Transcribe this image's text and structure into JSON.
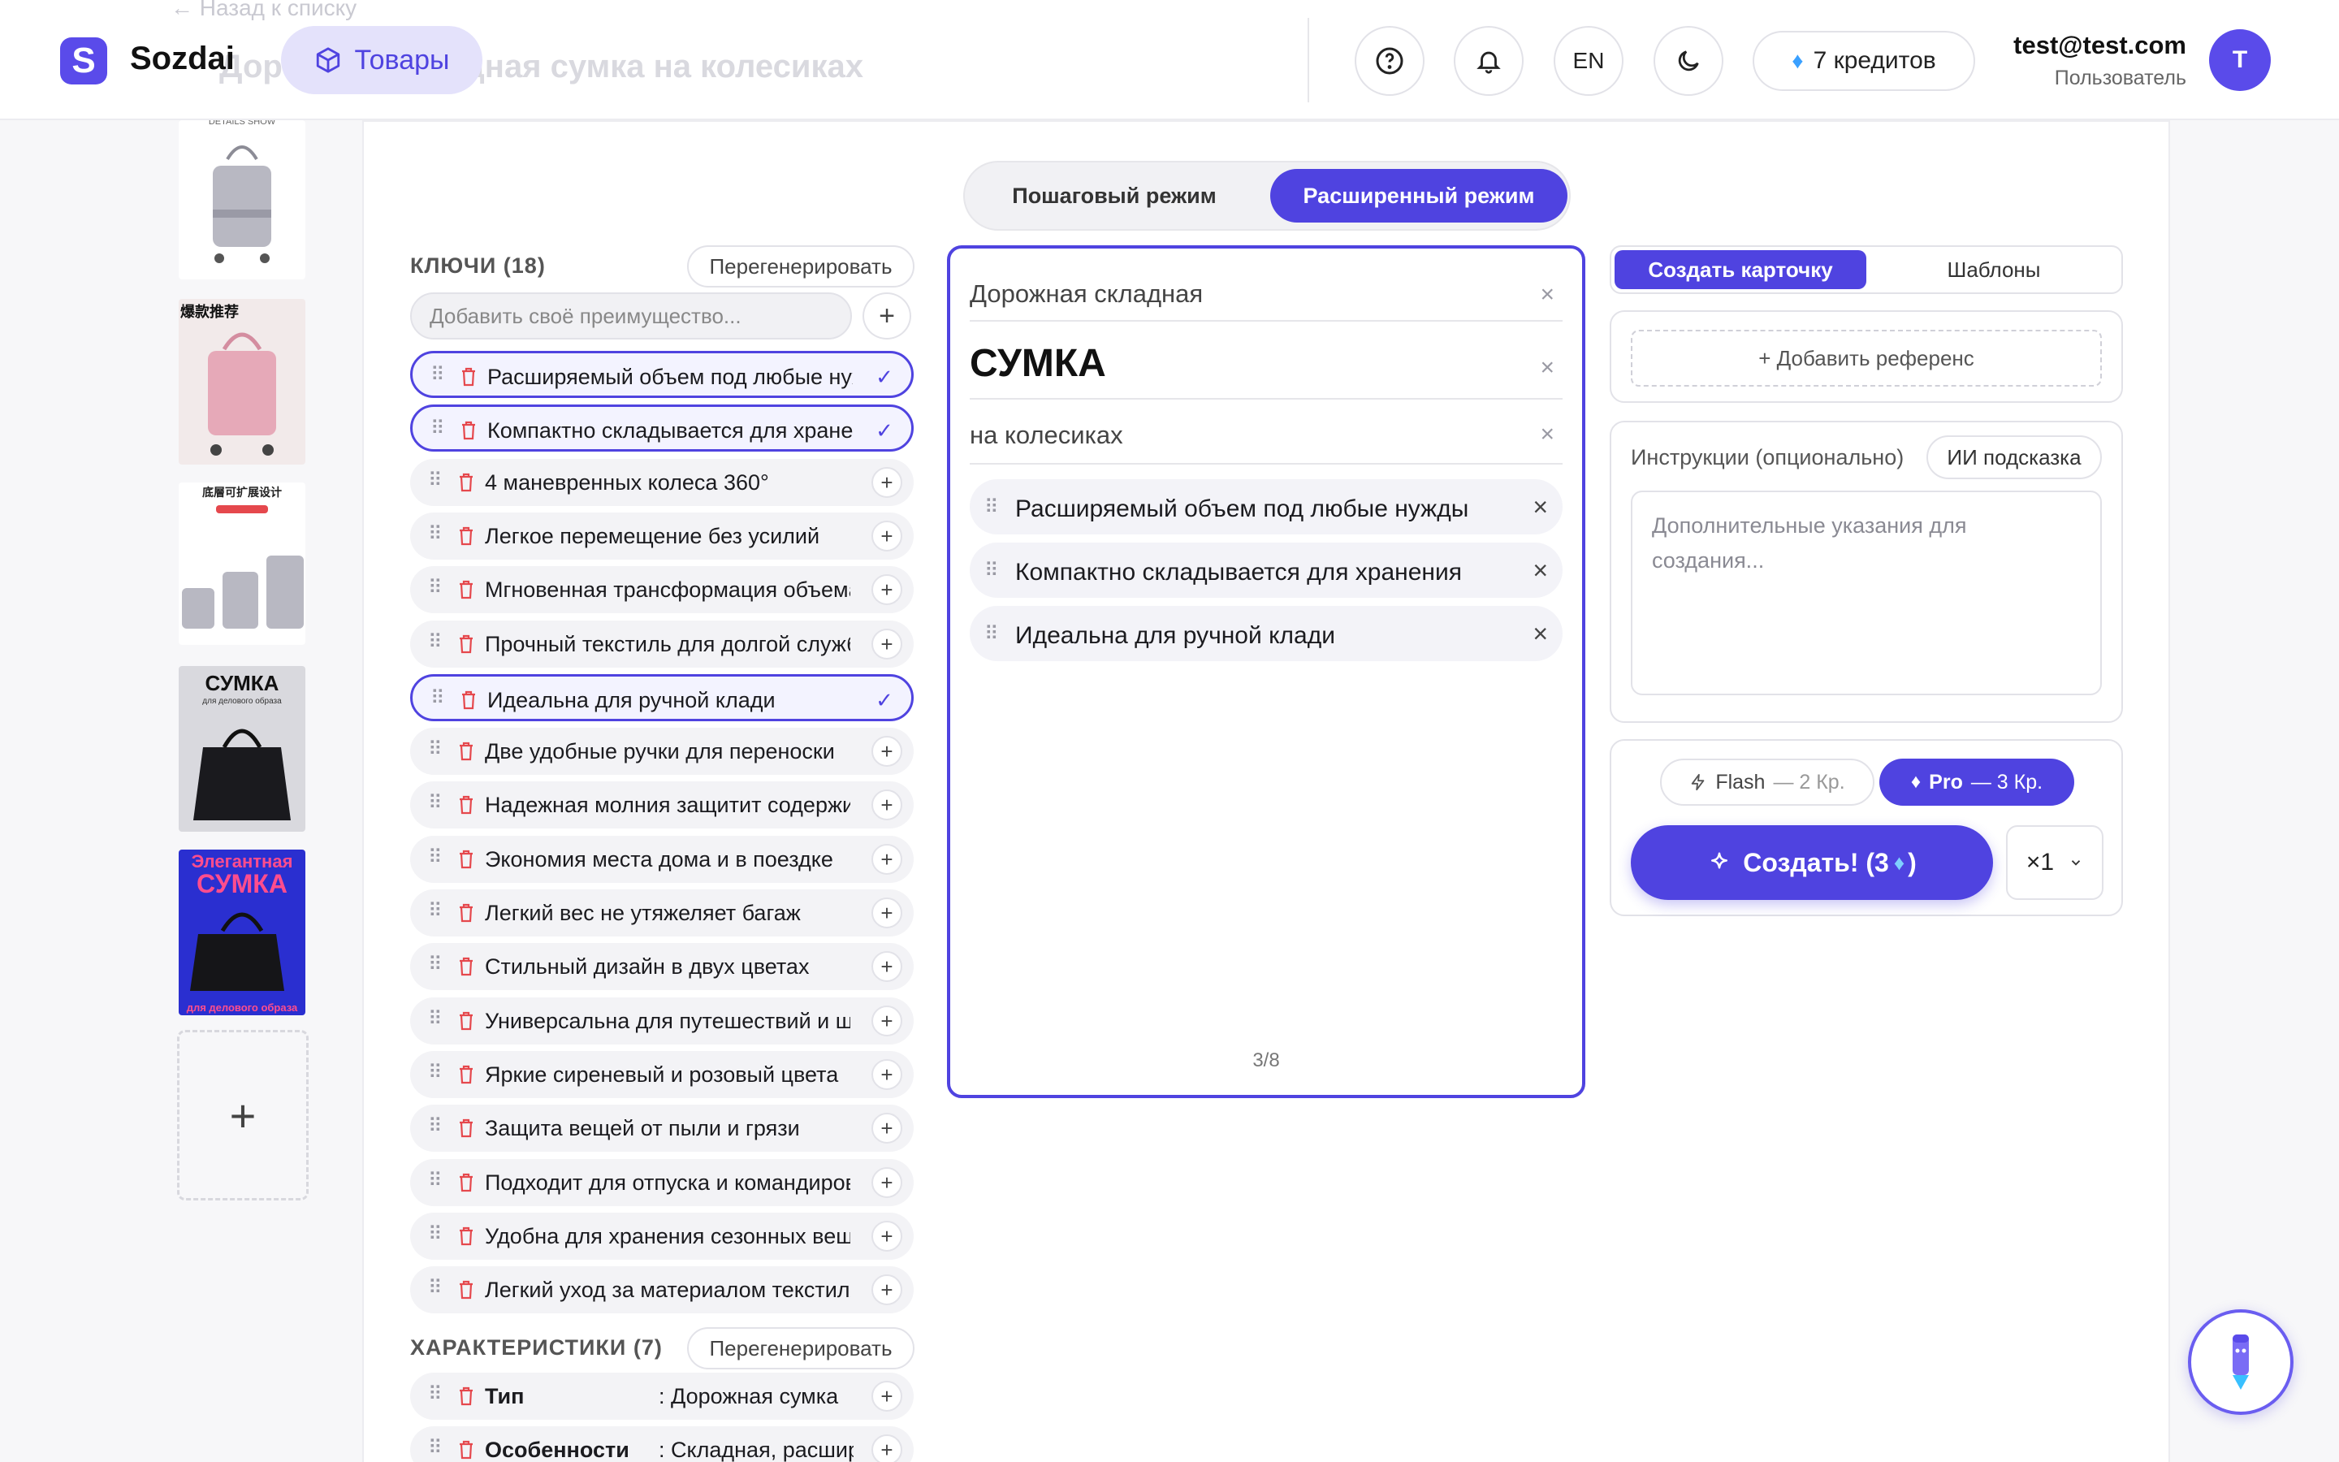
{
  "header": {
    "logo_mark": "S",
    "app_name": "Sozdai",
    "back_link": "← Назад к списку",
    "page_title": "Дорожная складная сумка на колесиках",
    "nav_label": "Товары",
    "lang": "EN",
    "credits": "7 кредитов",
    "user_email": "test@test.com",
    "user_role": "Пользователь",
    "avatar_letter": "T"
  },
  "modes": {
    "step": "Пошаговый режим",
    "advanced": "Расширенный режим",
    "active": "advanced"
  },
  "keys": {
    "title": "КЛЮЧИ (18)",
    "regen_label": "Перегенерировать",
    "add_placeholder": "Добавить своё преимущество...",
    "items": [
      {
        "label": "Расширяемый объем под любые нужды",
        "selected": true
      },
      {
        "label": "Компактно складывается для хранения",
        "selected": true
      },
      {
        "label": "4 маневренных колеса 360°",
        "selected": false
      },
      {
        "label": "Легкое перемещение без усилий",
        "selected": false
      },
      {
        "label": "Мгновенная трансформация объема",
        "selected": false
      },
      {
        "label": "Прочный текстиль для долгой службы",
        "selected": false
      },
      {
        "label": "Идеальна для ручной клади",
        "selected": true
      },
      {
        "label": "Две удобные ручки для переноски",
        "selected": false
      },
      {
        "label": "Надежная молния защитит содержимое",
        "selected": false
      },
      {
        "label": "Экономия места дома и в поездке",
        "selected": false
      },
      {
        "label": "Легкий вес не утяжеляет багаж",
        "selected": false
      },
      {
        "label": "Стильный дизайн в двух цветах",
        "selected": false
      },
      {
        "label": "Универсальна для путешествий и шопинга",
        "selected": false
      },
      {
        "label": "Яркие сиреневый и розовый цвета",
        "selected": false
      },
      {
        "label": "Защита вещей от пыли и грязи",
        "selected": false
      },
      {
        "label": "Подходит для отпуска и командировок",
        "selected": false
      },
      {
        "label": "Удобна для хранения сезонных вещей",
        "selected": false
      },
      {
        "label": "Легкий уход за материалом текстиля",
        "selected": false
      }
    ]
  },
  "characteristics": {
    "title": "ХАРАКТЕРИСТИКИ (7)",
    "regen_label": "Перегенерировать",
    "items": [
      {
        "name": "Тип",
        "value": ": Дорожная сумка"
      },
      {
        "name": "Особенности",
        "value": ": Складная, расширяемая"
      }
    ]
  },
  "editor": {
    "line1": "Дорожная складная",
    "line2": "СУМКА",
    "line3": "на колесиках",
    "chips": [
      "Расширяемый объем под любые нужды",
      "Компактно складывается для хранения",
      "Идеальна для ручной клади"
    ],
    "counter": "3/8"
  },
  "right": {
    "tab_create": "Создать карточку",
    "tab_templates": "Шаблоны",
    "add_reference": "+ Добавить референс",
    "instructions_label": "Инструкции (опционально)",
    "ai_hint": "ИИ подсказка",
    "instructions_placeholder": "Дополнительные указания для создания...",
    "model_flash": "Flash",
    "model_flash_cost": "— 2 Кр.",
    "model_pro": "Pro",
    "model_pro_cost": "— 3 Кр.",
    "create_label": "Создать! (3",
    "create_close": ")",
    "qty": "×1"
  },
  "thumbnails": {
    "t1_caption": "DETAILS SHOW",
    "t2_caption": "爆款推荐",
    "t3_caption": "底層可扩展设计",
    "t4_title": "СУМКА",
    "t4_sub": "для делового образа",
    "t5_title": "Элегантная",
    "t5_title2": "СУМКА",
    "t5_sub": "для делового образа"
  },
  "colors": {
    "accent": "#4f43e0",
    "accent_light": "#e4e2fb",
    "danger": "#e5484d"
  }
}
